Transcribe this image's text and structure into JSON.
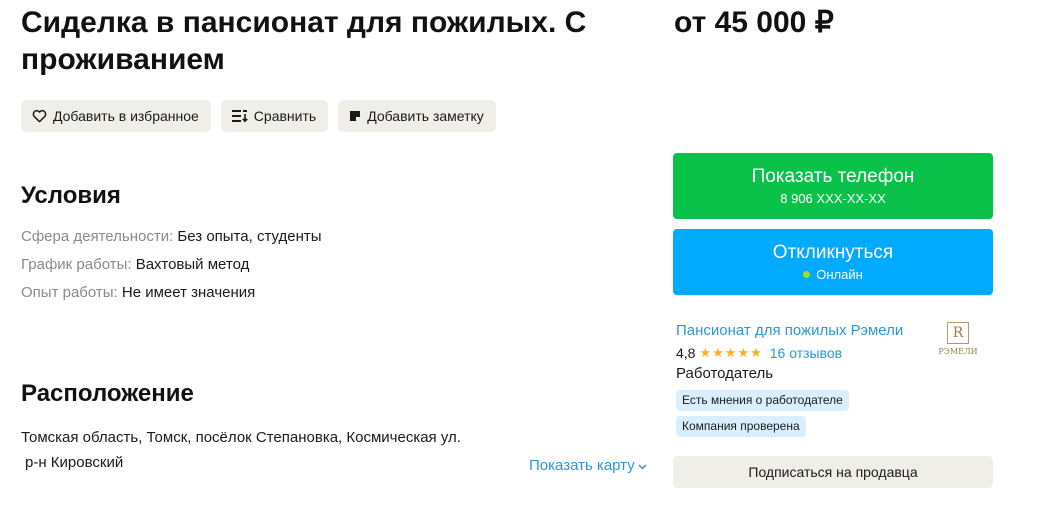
{
  "listing": {
    "title": "Сиделка в пансионат для пожилых. С проживанием",
    "price": "от 45 000 ₽"
  },
  "actions": {
    "favorite_label": "Добавить в избранное",
    "compare_label": "Сравнить",
    "note_label": "Добавить заметку"
  },
  "conditions": {
    "heading": "Условия",
    "rows": [
      {
        "label": "Сфера деятельности:",
        "value": "Без опыта, студенты"
      },
      {
        "label": "График работы:",
        "value": "Вахтовый метод"
      },
      {
        "label": "Опыт работы:",
        "value": "Не имеет значения"
      }
    ]
  },
  "location": {
    "heading": "Расположение",
    "address": "Томская область, Томск, посёлок Степановка, Космическая ул.",
    "district": "р-н Кировский",
    "map_link": "Показать карту"
  },
  "contact": {
    "phone_label": "Показать телефон",
    "phone_masked": "8 906 XXX-XX-XX",
    "reply_label": "Откликнуться",
    "online_status": "Онлайн"
  },
  "seller": {
    "name": "Пансионат для пожилых Рэмели",
    "rating": "4,8",
    "rating_stars": 5,
    "reviews": "16 отзывов",
    "type": "Работодатель",
    "badges": [
      "Есть мнения о работодателе",
      "Компания проверена"
    ],
    "logo_text": "РЭМЕЛИ",
    "subscribe_label": "Подписаться на продавца"
  },
  "colors": {
    "phone_button": "#0ac24a",
    "reply_button": "#00aaff",
    "link": "#2a98d8",
    "stars": "#ffb021",
    "badge_bg": "#d9efff"
  }
}
